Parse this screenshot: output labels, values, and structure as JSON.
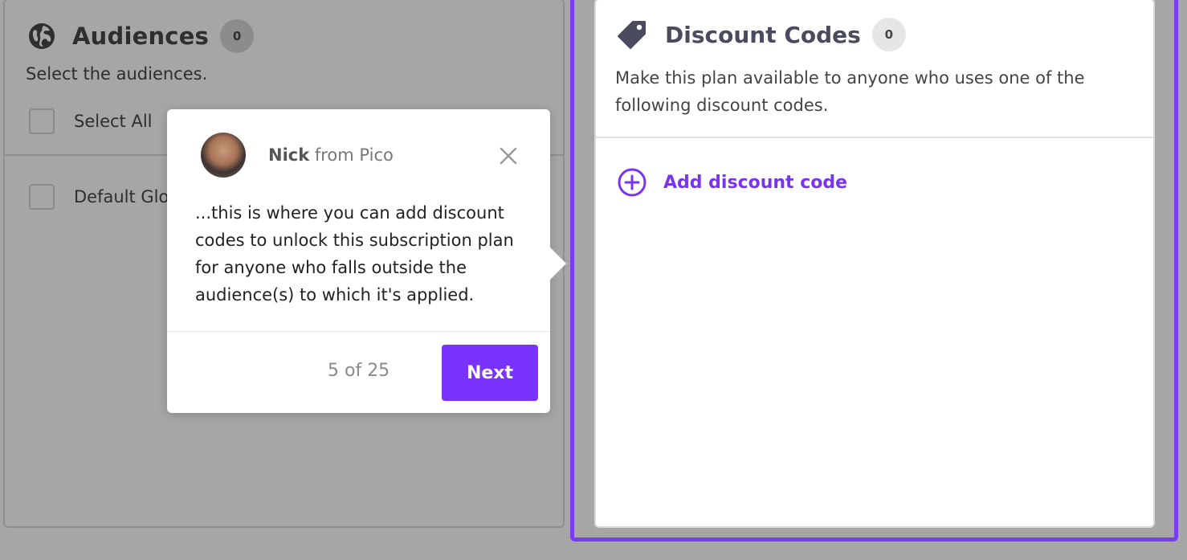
{
  "audiences": {
    "icon": "globe-icon",
    "title": "Audiences",
    "count": "0",
    "description": "Select the audiences.",
    "select_all_label": "Select All",
    "items": [
      {
        "label": "Default Glob"
      }
    ]
  },
  "discount_codes": {
    "icon": "tag-icon",
    "title": "Discount Codes",
    "count": "0",
    "description": "Make this plan available to anyone who uses one of the following discount codes.",
    "add_label": "Add discount code",
    "accent_color": "#7a33ef"
  },
  "tour": {
    "author_name": "Nick",
    "author_suffix": " from Pico",
    "body": "...this is where you can add discount codes to unlock this subscription plan for anyone who falls outside the audience(s) to which it's applied.",
    "progress": "5 of 25",
    "next_label": "Next",
    "button_color": "#7a33ff"
  },
  "overlay_color": "#a6a6a6"
}
